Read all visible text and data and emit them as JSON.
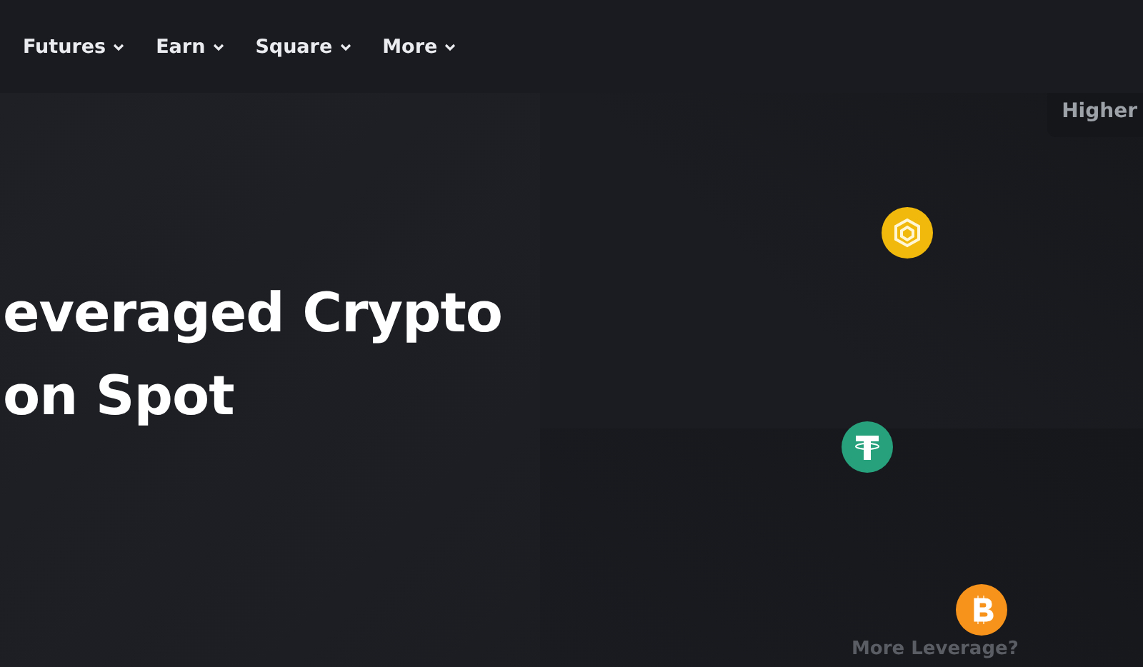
{
  "nav": {
    "items": [
      {
        "label": "Futures"
      },
      {
        "label": "Earn"
      },
      {
        "label": "Square"
      },
      {
        "label": "More"
      }
    ]
  },
  "hero": {
    "title_lines": [
      "everaged Crypto",
      "on Spot"
    ],
    "coins": [
      {
        "kind": "bnb"
      },
      {
        "kind": "usdt"
      },
      {
        "kind": "btc"
      }
    ],
    "top_card": "Higher",
    "bottom_caption": "More Leverage?"
  }
}
